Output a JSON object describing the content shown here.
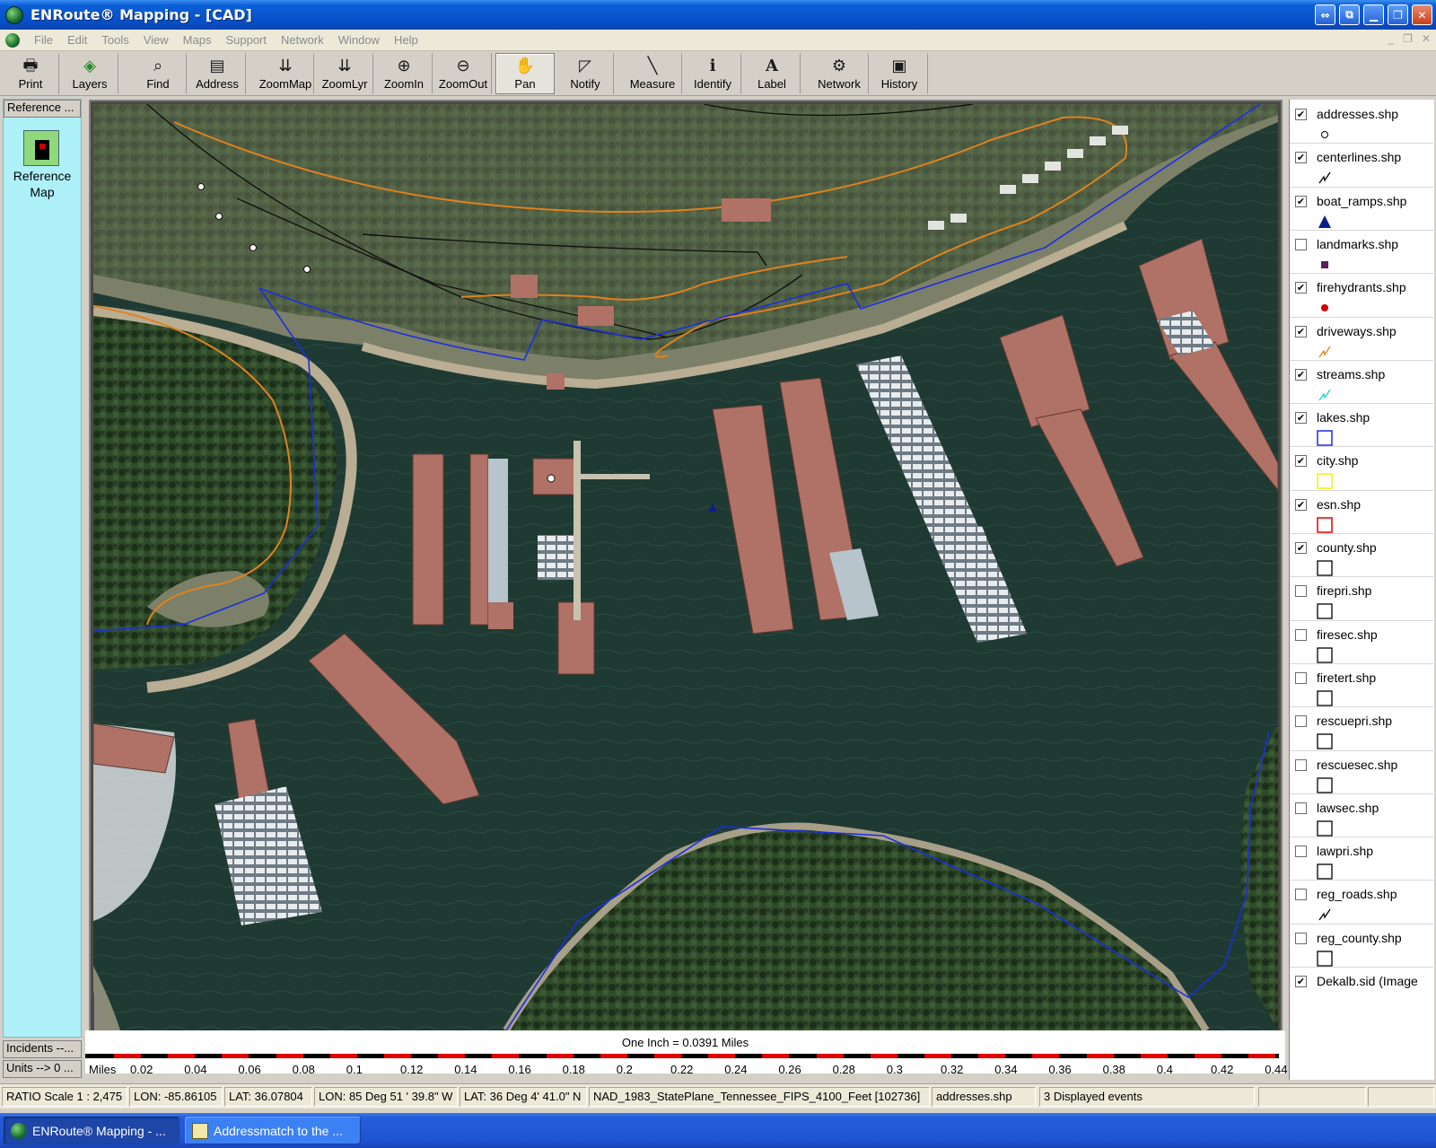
{
  "window": {
    "title": "ENRoute® Mapping - [CAD]"
  },
  "menu": [
    "File",
    "Edit",
    "Tools",
    "View",
    "Maps",
    "Support",
    "Network",
    "Window",
    "Help"
  ],
  "toolbar": [
    {
      "label": "Print",
      "icon": "printer-icon",
      "glyph": "🖶"
    },
    {
      "label": "Layers",
      "icon": "layers-icon",
      "glyph": "◈"
    },
    {
      "label": "Find",
      "icon": "binoculars-icon",
      "glyph": "⌕"
    },
    {
      "label": "Address",
      "icon": "address-card-icon",
      "glyph": "▤"
    },
    {
      "label": "ZoomMap",
      "icon": "zoom-map-icon",
      "glyph": "⇊"
    },
    {
      "label": "ZoomLyr",
      "icon": "zoom-layer-icon",
      "glyph": "⇊"
    },
    {
      "label": "ZoomIn",
      "icon": "zoom-in-icon",
      "glyph": "⊕"
    },
    {
      "label": "ZoomOut",
      "icon": "zoom-out-icon",
      "glyph": "⊖"
    },
    {
      "label": "Pan",
      "icon": "hand-icon",
      "glyph": "✋"
    },
    {
      "label": "Notify",
      "icon": "notify-icon",
      "glyph": "◸"
    },
    {
      "label": "Measure",
      "icon": "measure-line-icon",
      "glyph": "╲"
    },
    {
      "label": "Identify",
      "icon": "info-icon",
      "glyph": "ℹ"
    },
    {
      "label": "Label",
      "icon": "label-a-icon",
      "glyph": "A"
    },
    {
      "label": "Network",
      "icon": "network-icon",
      "glyph": "⚙"
    },
    {
      "label": "History",
      "icon": "history-icon",
      "glyph": "▣"
    }
  ],
  "active_tool": "Pan",
  "left_panel": {
    "tab_top": "Reference ...",
    "ref_label_line1": "Reference",
    "ref_label_line2": "Map",
    "tab_incidents": "Incidents --...",
    "tab_units": "Units --> 0 ..."
  },
  "scale": {
    "caption": "One Inch = 0.0391 Miles",
    "unit": "Miles",
    "ticks": [
      "0.02",
      "0.04",
      "0.06",
      "0.08",
      "0.1",
      "0.12",
      "0.14",
      "0.16",
      "0.18",
      "0.2",
      "0.22",
      "0.24",
      "0.26",
      "0.28",
      "0.3",
      "0.32",
      "0.34",
      "0.36",
      "0.38",
      "0.4",
      "0.42",
      "0.44"
    ]
  },
  "legend": [
    {
      "name": "addresses.shp",
      "checked": true,
      "symbol": "hollow-circle"
    },
    {
      "name": "centerlines.shp",
      "checked": true,
      "symbol": "black-line"
    },
    {
      "name": "boat_ramps.shp",
      "checked": true,
      "symbol": "blue-triangle"
    },
    {
      "name": "landmarks.shp",
      "checked": false,
      "symbol": "purple-square"
    },
    {
      "name": "firehydrants.shp",
      "checked": true,
      "symbol": "red-dot"
    },
    {
      "name": "driveways.shp",
      "checked": true,
      "symbol": "orange-line"
    },
    {
      "name": "streams.shp",
      "checked": true,
      "symbol": "cyan-line"
    },
    {
      "name": "lakes.shp",
      "checked": true,
      "symbol": "blue-box"
    },
    {
      "name": "city.shp",
      "checked": true,
      "symbol": "yellow-box"
    },
    {
      "name": "esn.shp",
      "checked": true,
      "symbol": "red-box"
    },
    {
      "name": "county.shp",
      "checked": true,
      "symbol": "black-box"
    },
    {
      "name": "firepri.shp",
      "checked": false,
      "symbol": "black-box"
    },
    {
      "name": "firesec.shp",
      "checked": false,
      "symbol": "black-box"
    },
    {
      "name": "firetert.shp",
      "checked": false,
      "symbol": "black-box"
    },
    {
      "name": "rescuepri.shp",
      "checked": false,
      "symbol": "black-box"
    },
    {
      "name": "rescuesec.shp",
      "checked": false,
      "symbol": "black-box"
    },
    {
      "name": "lawsec.shp",
      "checked": false,
      "symbol": "black-box"
    },
    {
      "name": "lawpri.shp",
      "checked": false,
      "symbol": "black-box"
    },
    {
      "name": "reg_roads.shp",
      "checked": false,
      "symbol": "black-line"
    },
    {
      "name": "reg_county.shp",
      "checked": false,
      "symbol": "black-box"
    },
    {
      "name": "Dekalb.sid (Image",
      "checked": true,
      "symbol": "none"
    }
  ],
  "status": {
    "ratio": "RATIO Scale 1 : 2,475",
    "lon_dec": "LON: -85.86105",
    "lat_dec": "LAT: 36.07804",
    "lon_dms": "LON: 85 Deg 51 ' 39.8\" W",
    "lat_dms": "LAT: 36 Deg 4' 41.0\" N",
    "projection": "NAD_1983_StatePlane_Tennessee_FIPS_4100_Feet [102736]",
    "layer": "addresses.shp",
    "events": "3 Displayed events"
  },
  "taskbar": [
    {
      "label": "ENRoute® Mapping - ...",
      "active": true,
      "icon": "globe-icon"
    },
    {
      "label": "Addressmatch to the ...",
      "active": false,
      "icon": "document-icon"
    }
  ],
  "colors": {
    "lake_boundary": "#1a2fe0",
    "driveways": "#e0821e",
    "centerlines": "#111111",
    "water": "#1f3a33",
    "roof": "#b07166"
  }
}
